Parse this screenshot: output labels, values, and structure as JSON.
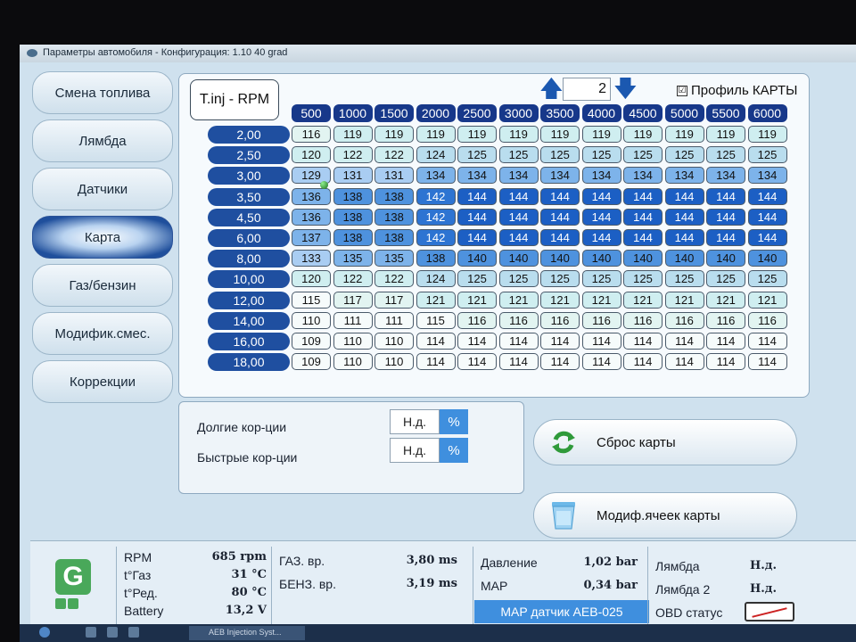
{
  "window": {
    "title": "Параметры автомобиля - Конфигурация: 1.10 40 grad"
  },
  "nav": [
    {
      "label": "Смена топлива",
      "active": false
    },
    {
      "label": "Лямбда",
      "active": false
    },
    {
      "label": "Датчики",
      "active": false
    },
    {
      "label": "Карта",
      "active": true
    },
    {
      "label": "Газ/бензин",
      "active": false
    },
    {
      "label": "Модифик.смес.",
      "active": false
    },
    {
      "label": "Коррекции",
      "active": false
    }
  ],
  "map": {
    "title": "T.inj - RPM",
    "page": "2",
    "profile_label": "Профиль КАРТЫ",
    "profile_checked": "☑",
    "rpm": [
      "500",
      "1000",
      "1500",
      "2000",
      "2500",
      "3000",
      "3500",
      "4000",
      "4500",
      "5000",
      "5500",
      "6000"
    ],
    "tinj": [
      "2,00",
      "2,50",
      "3,00",
      "3,50",
      "4,50",
      "6,00",
      "8,00",
      "10,00",
      "12,00",
      "14,00",
      "16,00",
      "18,00"
    ],
    "values": [
      [
        116,
        119,
        119,
        119,
        119,
        119,
        119,
        119,
        119,
        119,
        119,
        119
      ],
      [
        120,
        122,
        122,
        124,
        125,
        125,
        125,
        125,
        125,
        125,
        125,
        125
      ],
      [
        129,
        131,
        131,
        134,
        134,
        134,
        134,
        134,
        134,
        134,
        134,
        134
      ],
      [
        136,
        138,
        138,
        142,
        144,
        144,
        144,
        144,
        144,
        144,
        144,
        144
      ],
      [
        136,
        138,
        138,
        142,
        144,
        144,
        144,
        144,
        144,
        144,
        144,
        144
      ],
      [
        137,
        138,
        138,
        142,
        144,
        144,
        144,
        144,
        144,
        144,
        144,
        144
      ],
      [
        133,
        135,
        135,
        138,
        140,
        140,
        140,
        140,
        140,
        140,
        140,
        140
      ],
      [
        120,
        122,
        122,
        124,
        125,
        125,
        125,
        125,
        125,
        125,
        125,
        125
      ],
      [
        115,
        117,
        117,
        121,
        121,
        121,
        121,
        121,
        121,
        121,
        121,
        121
      ],
      [
        110,
        111,
        111,
        115,
        116,
        116,
        116,
        116,
        116,
        116,
        116,
        116
      ],
      [
        109,
        110,
        110,
        114,
        114,
        114,
        114,
        114,
        114,
        114,
        114,
        114
      ],
      [
        109,
        110,
        110,
        114,
        114,
        114,
        114,
        114,
        114,
        114,
        114,
        114
      ]
    ]
  },
  "corrections": {
    "long_label": "Долгие кор-ции",
    "long_value": "Н.д.",
    "short_label": "Быстрые кор-ции",
    "short_value": "Н.д.",
    "unit": "%"
  },
  "buttons": {
    "reset": "Сброс карты",
    "modify": "Модиф.ячеек карты"
  },
  "status": {
    "rpm_label": "RPM",
    "rpm": "685 rpm",
    "gas_temp_label": "t°Газ",
    "gas_temp": "31 °C",
    "red_temp_label": "t°Ред.",
    "red_temp": "80 °C",
    "battery_label": "Battery",
    "battery": "13,2 V",
    "gas_time_label": "ГАЗ. вр.",
    "gas_time": "3,80 ms",
    "petrol_time_label": "БЕНЗ. вр.",
    "petrol_time": "3,19 ms",
    "pressure_label": "Давление",
    "pressure": "1,02 bar",
    "map_label": "MAP",
    "map": "0,34 bar",
    "map_sensor": "MAP датчик AEB-025",
    "lambda_label": "Лямбда",
    "lambda": "Н.д.",
    "lambda2_label": "Лямбда 2",
    "lambda2": "Н.д.",
    "obd_label": "OBD статус"
  },
  "logo": "G",
  "taskbar": {
    "task_label": "AEB Injection Syst..."
  }
}
